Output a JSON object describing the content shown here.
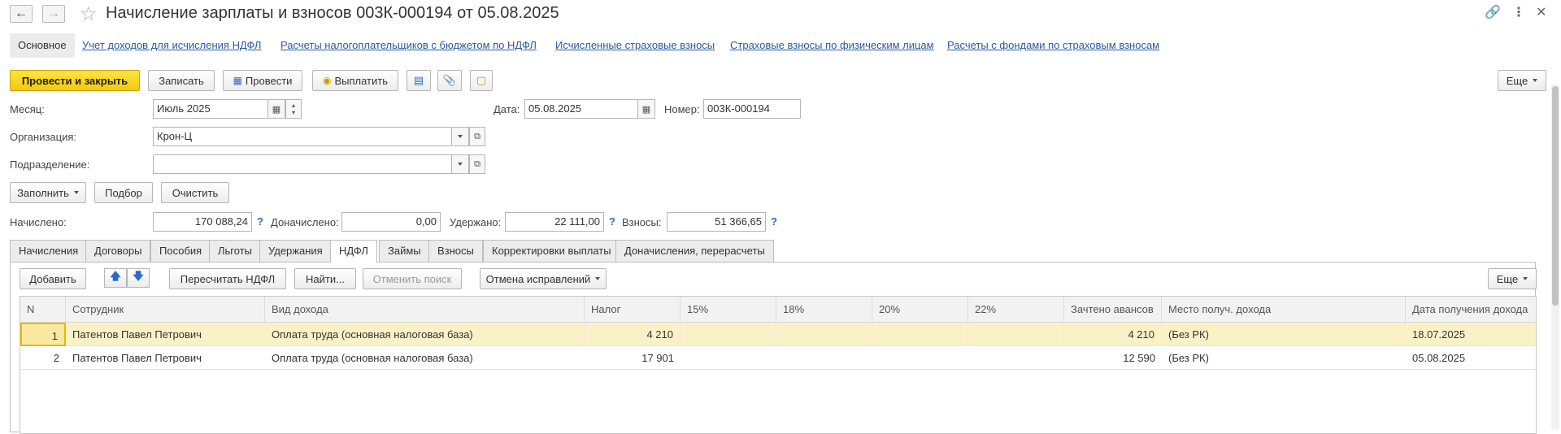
{
  "title": "Начисление зарплаты и взносов 003К-000194 от 05.08.2025",
  "nav": {
    "main": "Основное",
    "links": [
      "Учет доходов для исчисления НДФЛ",
      "Расчеты налогоплательщиков с бюджетом по НДФЛ",
      "Исчисленные страховые взносы",
      "Страховые взносы по физическим лицам",
      "Расчеты с фондами по страховым взносам"
    ]
  },
  "toolbar": {
    "post_close": "Провести и закрыть",
    "save": "Записать",
    "post": "Провести",
    "pay": "Выплатить",
    "more": "Еще"
  },
  "form": {
    "month_label": "Месяц:",
    "month_value": "Июль 2025",
    "date_label": "Дата:",
    "date_value": "05.08.2025",
    "number_label": "Номер:",
    "number_value": "003К-000194",
    "org_label": "Организация:",
    "org_value": "Крон-Ц",
    "dept_label": "Подразделение:",
    "dept_value": ""
  },
  "actions": {
    "fill": "Заполнить",
    "pick": "Подбор",
    "clear": "Очистить"
  },
  "totals": {
    "accrued_label": "Начислено:",
    "accrued_value": "170 088,24",
    "additional_label": "Доначислено:",
    "additional_value": "0,00",
    "withheld_label": "Удержано:",
    "withheld_value": "22 111,00",
    "contrib_label": "Взносы:",
    "contrib_value": "51 366,65",
    "help": "?"
  },
  "tabs": [
    "Начисления",
    "Договоры",
    "Пособия",
    "Льготы",
    "Удержания",
    "НДФЛ",
    "Займы",
    "Взносы",
    "Корректировки выплаты",
    "Доначисления, перерасчеты"
  ],
  "panel_toolbar": {
    "add": "Добавить",
    "recalc": "Пересчитать НДФЛ",
    "find": "Найти...",
    "cancel_search": "Отменить поиск",
    "cancel_fixes": "Отмена исправлений",
    "more": "Еще"
  },
  "table": {
    "columns": [
      "N",
      "Сотрудник",
      "Вид дохода",
      "Налог",
      "15%",
      "18%",
      "20%",
      "22%",
      "Зачтено авансов",
      "Место получ. дохода",
      "Дата получения дохода"
    ],
    "rows": [
      [
        "1",
        "Патентов Павел Петрович",
        "Оплата труда (основная налоговая база)",
        "4 210",
        "",
        "",
        "",
        "",
        "4 210",
        "(Без РК)",
        "18.07.2025"
      ],
      [
        "2",
        "Патентов Павел Петрович",
        "Оплата труда (основная налоговая база)",
        "17 901",
        "",
        "",
        "",
        "",
        "12 590",
        "(Без РК)",
        "05.08.2025"
      ]
    ]
  }
}
